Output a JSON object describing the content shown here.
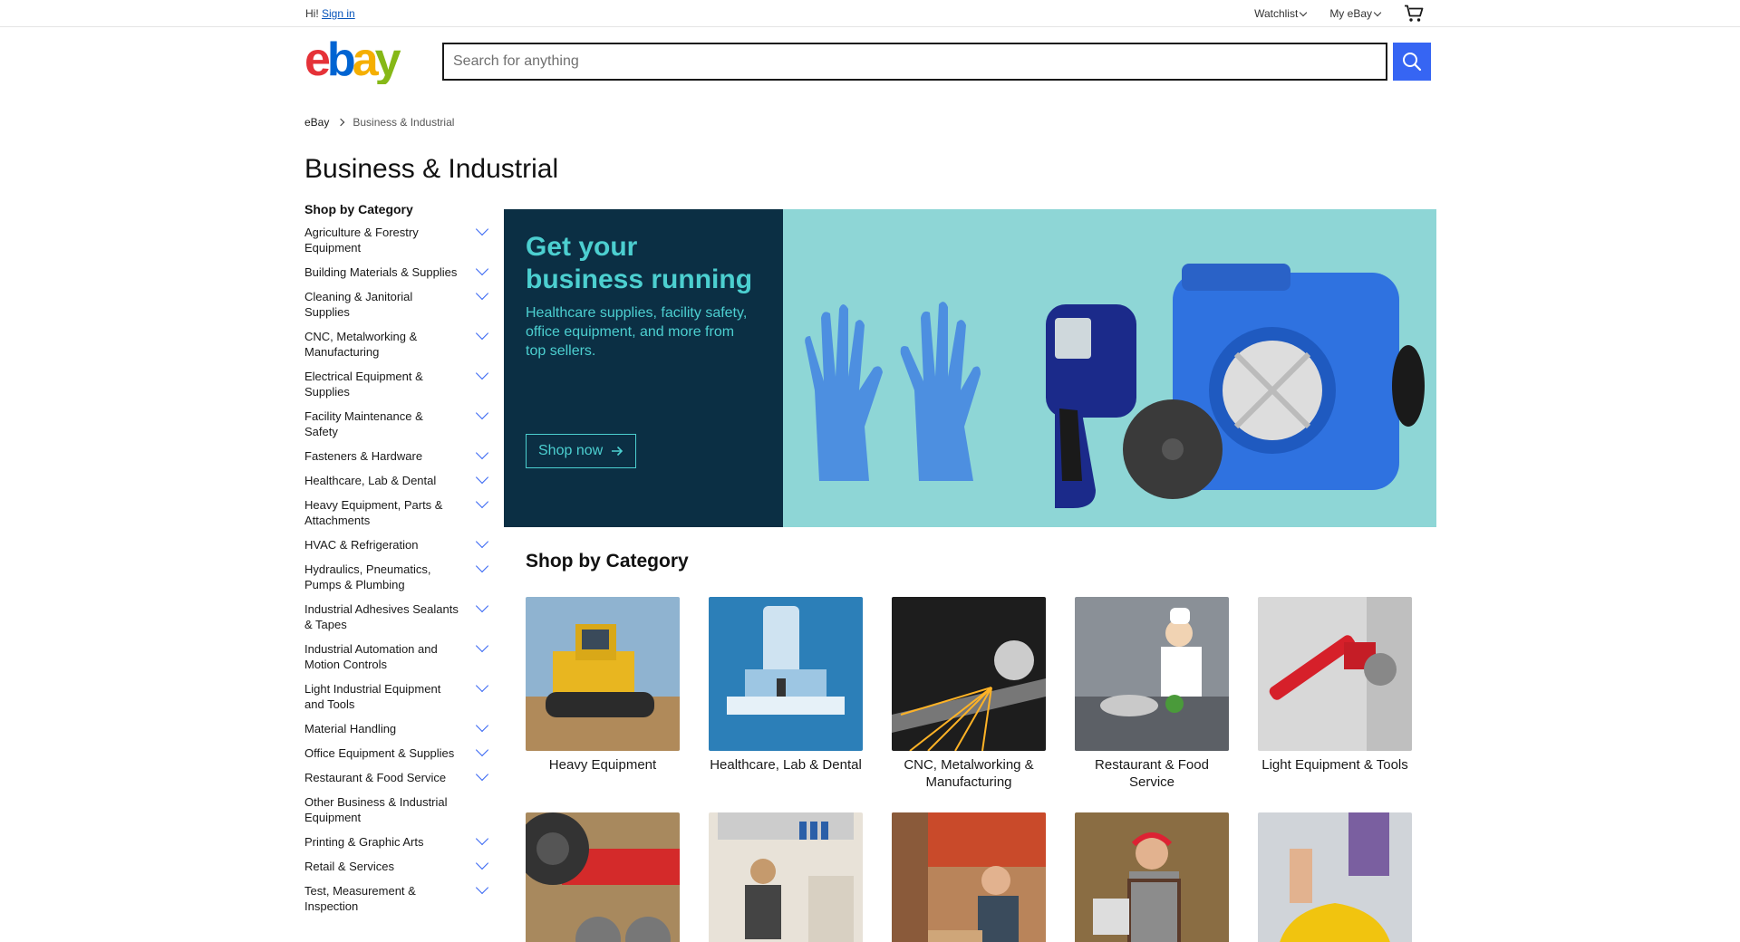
{
  "topbar": {
    "greeting": "Hi!",
    "sign_in": "Sign in",
    "watchlist": "Watchlist",
    "my_ebay": "My eBay"
  },
  "header": {
    "search_placeholder": "Search for anything",
    "search_value": ""
  },
  "breadcrumb": {
    "home": "eBay",
    "current": "Business & Industrial"
  },
  "page_title": "Business & Industrial",
  "sidebar": {
    "heading": "Shop by Category",
    "items": [
      {
        "label": "Agriculture & Forestry Equipment",
        "expandable": true
      },
      {
        "label": "Building Materials & Supplies",
        "expandable": true
      },
      {
        "label": "Cleaning & Janitorial Supplies",
        "expandable": true
      },
      {
        "label": "CNC, Metalworking & Manufacturing",
        "expandable": true
      },
      {
        "label": "Electrical Equipment & Supplies",
        "expandable": true
      },
      {
        "label": "Facility Maintenance & Safety",
        "expandable": true
      },
      {
        "label": "Fasteners & Hardware",
        "expandable": true
      },
      {
        "label": "Healthcare, Lab & Dental",
        "expandable": true
      },
      {
        "label": "Heavy Equipment, Parts & Attachments",
        "expandable": true
      },
      {
        "label": "HVAC & Refrigeration",
        "expandable": true
      },
      {
        "label": "Hydraulics, Pneumatics, Pumps & Plumbing",
        "expandable": true
      },
      {
        "label": "Industrial Adhesives Sealants & Tapes",
        "expandable": true
      },
      {
        "label": "Industrial Automation and Motion Controls",
        "expandable": true
      },
      {
        "label": "Light Industrial Equipment and Tools",
        "expandable": true
      },
      {
        "label": "Material Handling",
        "expandable": true
      },
      {
        "label": "Office Equipment & Supplies",
        "expandable": true
      },
      {
        "label": "Restaurant & Food Service",
        "expandable": true
      },
      {
        "label": "Other Business & Industrial Equipment",
        "expandable": false
      },
      {
        "label": "Printing & Graphic Arts",
        "expandable": true
      },
      {
        "label": "Retail & Services",
        "expandable": true
      },
      {
        "label": "Test, Measurement & Inspection",
        "expandable": true
      }
    ]
  },
  "hero": {
    "headline": "Get your business running",
    "subtext": "Healthcare supplies, facility safety, office equipment, and more from top sellers.",
    "cta": "Shop now",
    "bg_dark": "#0b2f44",
    "bg_light": "#8ed6d6",
    "accent": "#4ccfd0"
  },
  "categories": {
    "heading": "Shop by Category",
    "cards": [
      {
        "label": "Heavy Equipment"
      },
      {
        "label": "Healthcare, Lab & Dental"
      },
      {
        "label": "CNC, Metalworking & Manufacturing"
      },
      {
        "label": "Restaurant & Food Service"
      },
      {
        "label": "Light Equipment & Tools"
      },
      {
        "label": ""
      },
      {
        "label": ""
      },
      {
        "label": ""
      },
      {
        "label": ""
      },
      {
        "label": ""
      }
    ]
  },
  "colors": {
    "brand_blue": "#3665f3",
    "link_blue": "#0654ba"
  }
}
